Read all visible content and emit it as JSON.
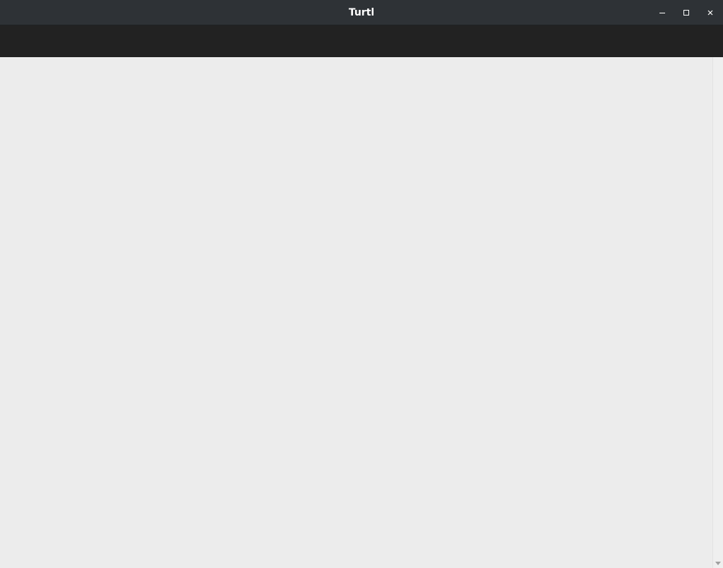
{
  "window": {
    "title": "Turtl",
    "controls": {
      "minimize_icon": "minimize-icon",
      "maximize_icon": "maximize-icon",
      "close_icon": "close-icon"
    }
  },
  "colors": {
    "titlebar": "#2e3236",
    "toolbar": "#222222",
    "content_background": "#ececec"
  }
}
